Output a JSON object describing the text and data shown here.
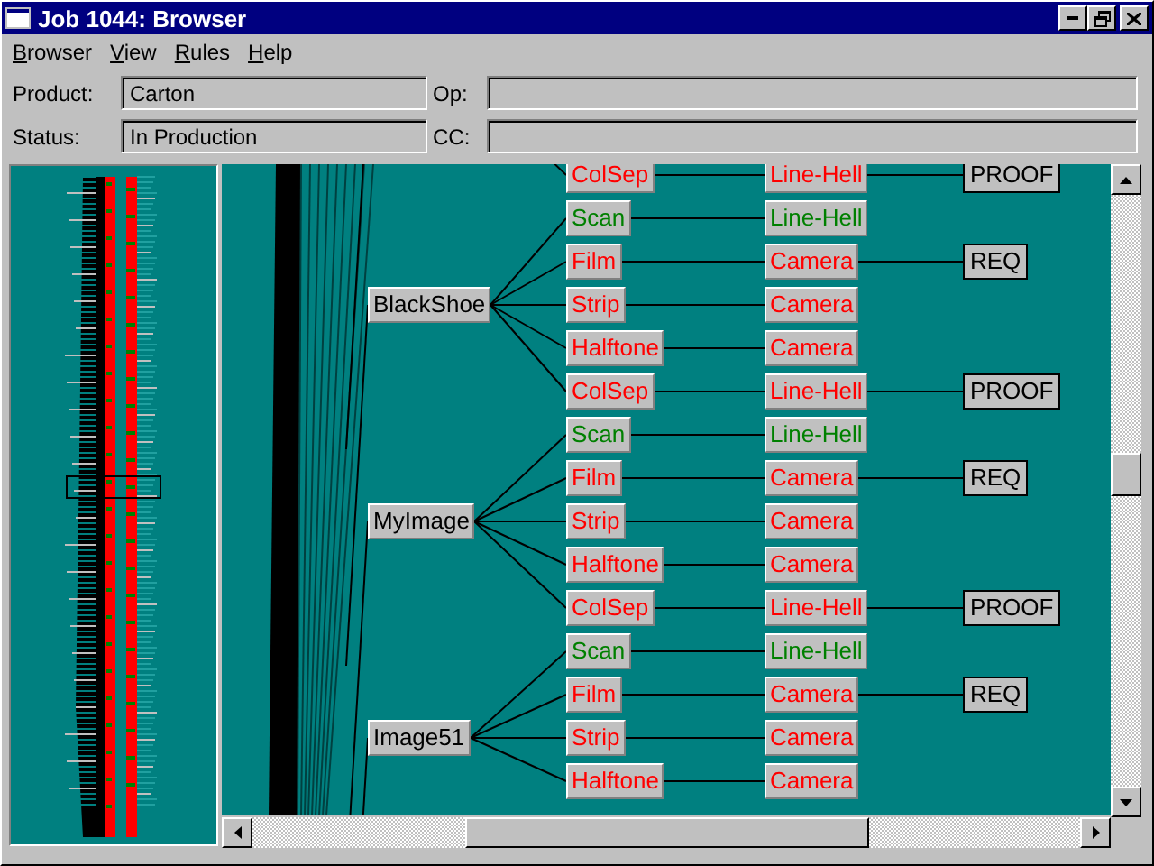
{
  "window": {
    "title": "Job 1044: Browser"
  },
  "menu": [
    "Browser",
    "View",
    "Rules",
    "Help"
  ],
  "fields": [
    {
      "label": "Product:",
      "value": "Carton"
    },
    {
      "label": "Op:"
    },
    {
      "label": "Status:",
      "value": "In Production"
    },
    {
      "label": "CC:"
    }
  ],
  "images": [
    {
      "tasks": [
        {
          "name": "ColSep",
          "complete": false,
          "device": {
            "name": "Line-Hell",
            "complete": false
          },
          "output": "PROOF"
        }
      ]
    },
    {
      "name": "BlackShoe",
      "tasks": [
        {
          "name": "Scan",
          "complete": true,
          "device": {
            "name": "Line-Hell",
            "complete": true
          }
        },
        {
          "name": "Film",
          "complete": false,
          "device": {
            "name": "Camera",
            "complete": false
          },
          "output": "REQ"
        },
        {
          "name": "Strip",
          "complete": false,
          "device": {
            "name": "Camera",
            "complete": false
          }
        },
        {
          "name": "Halftone",
          "complete": false,
          "device": {
            "name": "Camera",
            "complete": false
          }
        },
        {
          "name": "ColSep",
          "complete": false,
          "device": {
            "name": "Line-Hell",
            "complete": false
          },
          "output": "PROOF"
        }
      ]
    },
    {
      "name": "MyImage",
      "tasks": [
        {
          "name": "Scan",
          "complete": true,
          "device": {
            "name": "Line-Hell",
            "complete": true
          }
        },
        {
          "name": "Film",
          "complete": false,
          "device": {
            "name": "Camera",
            "complete": false
          },
          "output": "REQ"
        },
        {
          "name": "Strip",
          "complete": false,
          "device": {
            "name": "Camera",
            "complete": false
          }
        },
        {
          "name": "Halftone",
          "complete": false,
          "device": {
            "name": "Camera",
            "complete": false
          }
        },
        {
          "name": "ColSep",
          "complete": false,
          "device": {
            "name": "Line-Hell",
            "complete": false
          },
          "output": "PROOF"
        }
      ]
    },
    {
      "name": "Image51",
      "tasks": [
        {
          "name": "Scan",
          "complete": true,
          "device": {
            "name": "Line-Hell",
            "complete": true
          }
        },
        {
          "name": "Film",
          "complete": false,
          "device": {
            "name": "Camera",
            "complete": false
          },
          "output": "REQ"
        },
        {
          "name": "Strip",
          "complete": false,
          "device": {
            "name": "Camera",
            "complete": false
          }
        },
        {
          "name": "Halftone",
          "complete": false,
          "device": {
            "name": "Camera",
            "complete": false
          }
        }
      ]
    }
  ]
}
